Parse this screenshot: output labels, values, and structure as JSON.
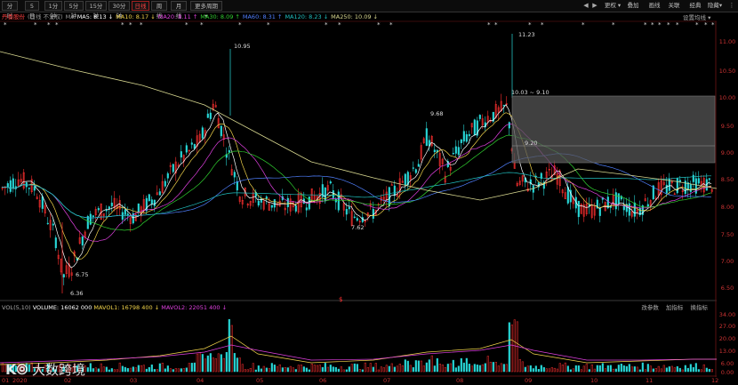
{
  "toolbar": {
    "period_tabs": [
      "分时",
      "5日",
      "1分钟",
      "5分钟",
      "15分钟",
      "30分钟",
      "60分钟",
      "日线",
      "周线",
      "月线",
      "更多周期 ▾"
    ],
    "active_tab": "日线",
    "right_tabs": [
      "叠加",
      "画线",
      "关联",
      "经典",
      "隐藏▾"
    ],
    "right_icons": [
      "settings-icon",
      "more-icon"
    ],
    "zoom_icons": [
      "◀",
      "▶",
      "更权 ▾"
    ]
  },
  "legend": {
    "title": "丹香股份",
    "subtitle": "(日线 不复权)",
    "ma_label": "MA",
    "ma5": "MA5: 8.13 ↓",
    "ma10": "MA10: 8.17 ↓",
    "ma20": "MA20: 8.11 ↑",
    "ma30": "MA30: 8.09 ↑",
    "ma60": "MA60: 8.31 ↑",
    "ma120": "MA120: 8.23 ↓",
    "ma250": "MA250: 10.09 ↓"
  },
  "settings_label": "设置均线 ▾",
  "colors": {
    "up": "#ff3030",
    "down": "#28d8d8",
    "ma5": "#ffffff",
    "ma10": "#f2d44a",
    "ma20": "#e040e0",
    "ma30": "#30d030",
    "ma60": "#5080ff",
    "ma120": "#20c0c0",
    "ma250": "#d8d890",
    "axis_label": "#d03030"
  },
  "price_axis": [
    "11.00",
    "10.50",
    "10.00",
    "9.50",
    "9.00",
    "8.50",
    "8.00",
    "7.50",
    "7.00",
    "6.50"
  ],
  "annotations": {
    "high1": "10.95",
    "high2": "11.23",
    "low": "6.36",
    "low2": "6.75",
    "low3": "7.62",
    "mid": "9.68",
    "box_top": "10.03 ~ 9.10",
    "box_mid": "9.20"
  },
  "volume": {
    "title": "VOL(5,10)",
    "volume": "VOLUME: 16062 000",
    "mavol1": "MAVOL1: 16798 400 ↓",
    "mavol2": "MAVOL2: 22051 400 ↓",
    "tools": [
      "改参数",
      "加指标",
      "换指标"
    ],
    "axis": [
      "34.00",
      "27.00",
      "20.00",
      "13.00",
      "6.00",
      "0.00"
    ]
  },
  "x_axis": [
    "01",
    "2020",
    "02",
    "03",
    "04",
    "05",
    "06",
    "07",
    "08",
    "09",
    "10",
    "11",
    "12"
  ],
  "watermark": "大数跨境"
}
